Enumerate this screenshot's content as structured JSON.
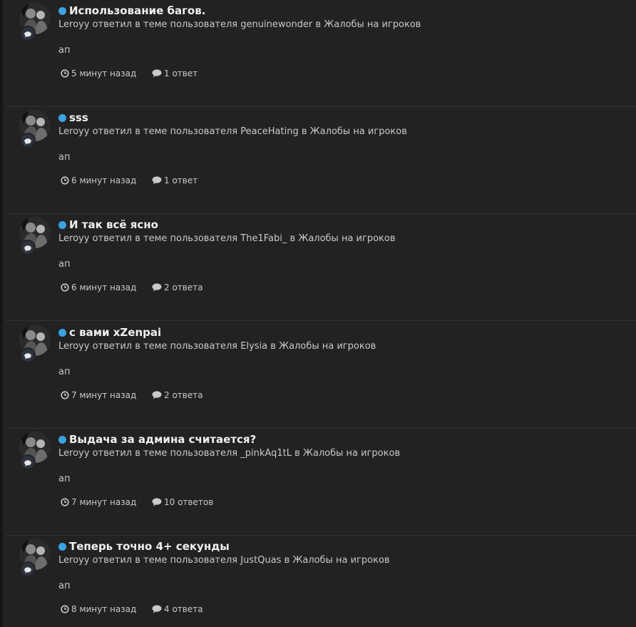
{
  "colors": {
    "unread_dot": "#3aa3e3",
    "background": "#222222",
    "title_text": "#f0f0f0",
    "secondary_text": "#c9c9c9"
  },
  "icons": {
    "badge": "comment-icon",
    "time": "clock-icon",
    "replies": "comment-icon",
    "unread": "unread-dot"
  },
  "activity": [
    {
      "title": "Использование багов.",
      "author": "Leroyy",
      "action": "ответил в теме пользователя",
      "topic_author": "genuinewonder",
      "in_word": "в",
      "forum": "Жалобы на игроков",
      "snippet": "ап",
      "time": "5 минут назад",
      "replies": "1 ответ"
    },
    {
      "title": "sss",
      "author": "Leroyy",
      "action": "ответил в теме пользователя",
      "topic_author": "PeaceHating",
      "in_word": "в",
      "forum": "Жалобы на игроков",
      "snippet": "ап",
      "time": "6 минут назад",
      "replies": "1 ответ"
    },
    {
      "title": "И так всё ясно",
      "author": "Leroyy",
      "action": "ответил в теме пользователя",
      "topic_author": "The1Fabi_",
      "in_word": "в",
      "forum": "Жалобы на игроков",
      "snippet": "ап",
      "time": "6 минут назад",
      "replies": "2 ответа"
    },
    {
      "title": "с вами xZenpai",
      "author": "Leroyy",
      "action": "ответил в теме пользователя",
      "topic_author": "Elysia",
      "in_word": "в",
      "forum": "Жалобы на игроков",
      "snippet": "ап",
      "time": "7 минут назад",
      "replies": "2 ответа"
    },
    {
      "title": "Выдача за админа считается?",
      "author": "Leroyy",
      "action": "ответил в теме пользователя",
      "topic_author": "_pinkAq1tL",
      "in_word": "в",
      "forum": "Жалобы на игроков",
      "snippet": "ап",
      "time": "7 минут назад",
      "replies": "10 ответов"
    },
    {
      "title": "Теперь точно 4+ секунды",
      "author": "Leroyy",
      "action": "ответил в теме пользователя",
      "topic_author": "JustQuas",
      "in_word": "в",
      "forum": "Жалобы на игроков",
      "snippet": "ап",
      "time": "8 минут назад",
      "replies": "4 ответа"
    }
  ]
}
